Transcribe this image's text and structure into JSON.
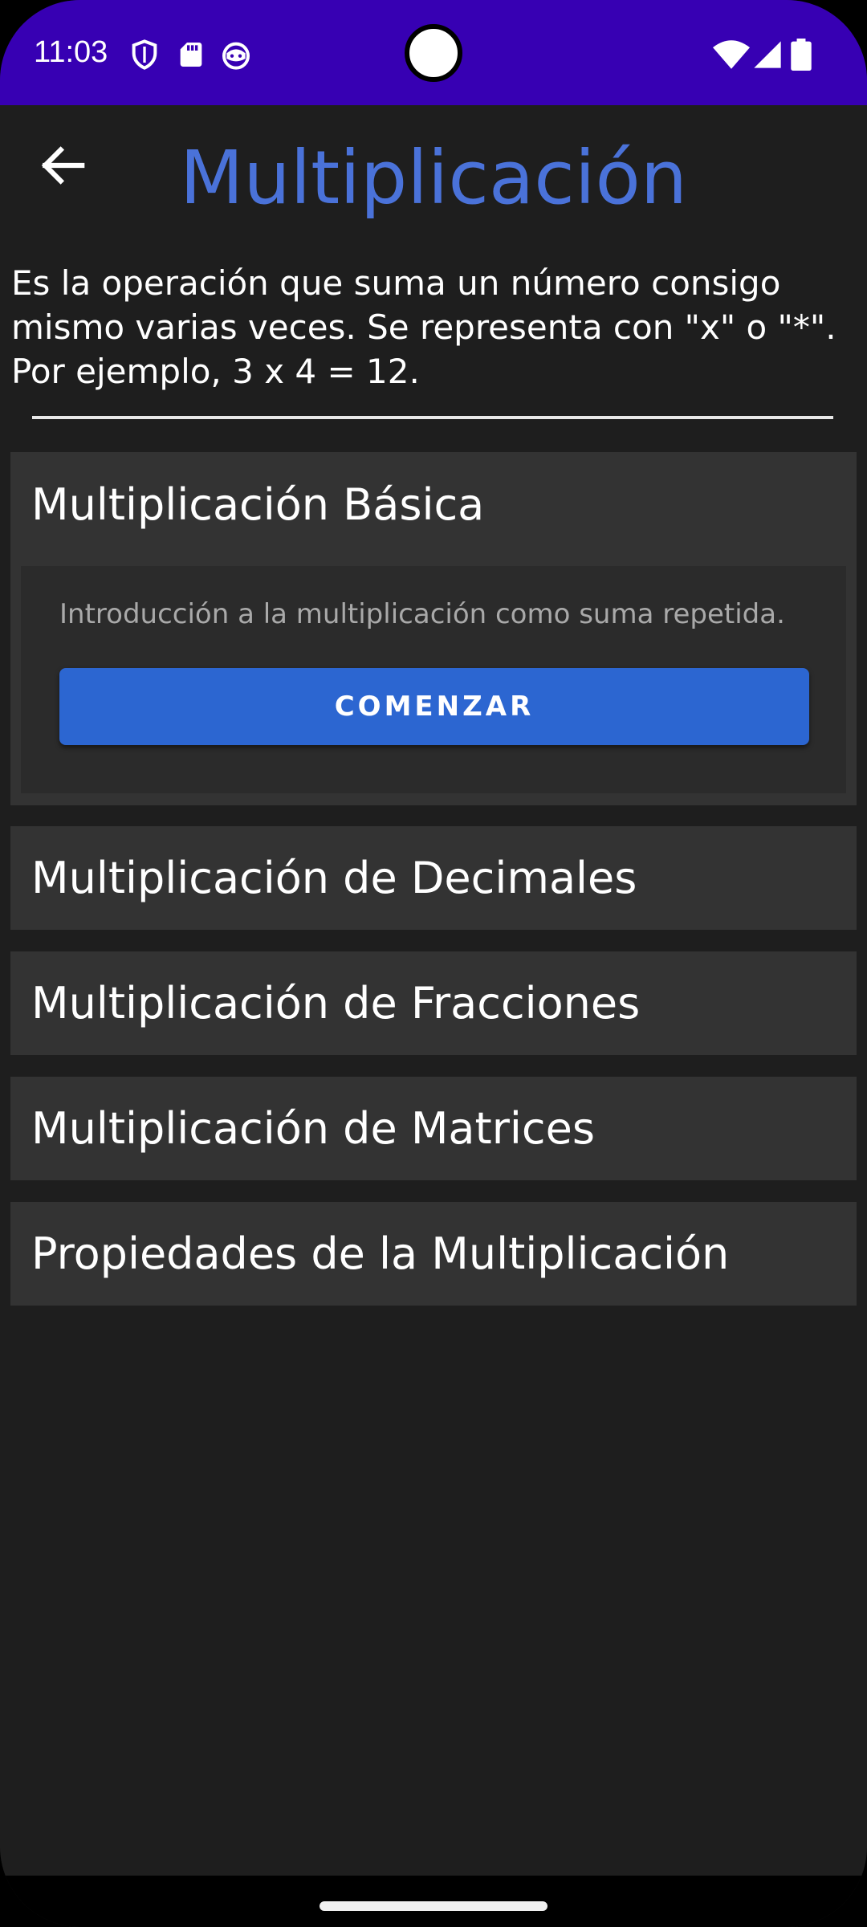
{
  "status_bar": {
    "time": "11:03",
    "background": "#3700b3",
    "left_icons": [
      "shield-icon",
      "sd-card-icon",
      "robot-icon"
    ],
    "right_icons": [
      "wifi-icon",
      "signal-icon",
      "battery-icon"
    ]
  },
  "header": {
    "title": "Multiplicación",
    "title_color": "#4a72d9",
    "back_icon": "arrow-left-icon"
  },
  "description": " Es la operación que suma un número consigo\nmismo varias veces. Se representa con \"x\" o \"*\".\nPor ejemplo, 3 x 4 = 12.",
  "sections": [
    {
      "title": "Multiplicación Básica",
      "expanded": true,
      "content": "Introducción a la multiplicación como suma repetida.",
      "button_label": "COMENZAR"
    },
    {
      "title": "Multiplicación de Decimales",
      "expanded": false
    },
    {
      "title": "Multiplicación de Fracciones",
      "expanded": false
    },
    {
      "title": "Multiplicación de Matrices",
      "expanded": false
    },
    {
      "title": "Propiedades de la Multiplicación",
      "expanded": false
    }
  ],
  "colors": {
    "background": "#1e1e1e",
    "section_bg": "#333333",
    "panel_bg": "#2b2b2b",
    "accent_button": "#2c66d1"
  }
}
